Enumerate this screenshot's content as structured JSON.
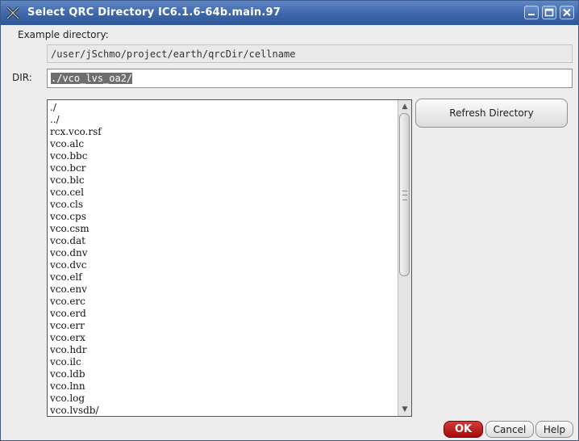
{
  "window": {
    "title": "Select QRC Directory IC6.1.6-64b.main.97"
  },
  "example": {
    "label": "Example directory:",
    "value": "/user/jSchmo/project/earth/qrcDir/cellname"
  },
  "dir": {
    "label": "DIR:",
    "value": "./vco_lvs_oa2/"
  },
  "list": {
    "items": [
      "./",
      "../",
      "rcx.vco.rsf",
      "vco.alc",
      "vco.bbc",
      "vco.bcr",
      "vco.blc",
      "vco.cel",
      "vco.cls",
      "vco.cps",
      "vco.csm",
      "vco.dat",
      "vco.dnv",
      "vco.dvc",
      "vco.elf",
      "vco.env",
      "vco.erc",
      "vco.erd",
      "vco.err",
      "vco.erx",
      "vco.hdr",
      "vco.ilc",
      "vco.ldb",
      "vco.lnn",
      "vco.log",
      "vco.lvsdb/"
    ]
  },
  "buttons": {
    "refresh": "Refresh Directory",
    "ok": "OK",
    "cancel": "Cancel",
    "help": "Help"
  },
  "icons": {
    "app": "x-tools-icon",
    "minimize": "minimize-icon",
    "maximize": "maximize-icon",
    "close": "close-icon"
  },
  "colors": {
    "titlebar": "#3e67aa",
    "ok_button": "#c01a1a",
    "selection": "#6e6e6e"
  }
}
